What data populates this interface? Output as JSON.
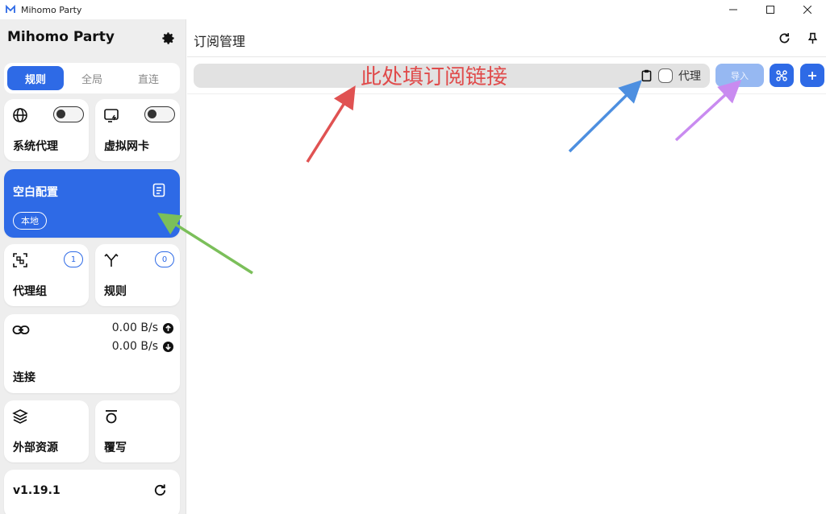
{
  "window": {
    "title": "Mihomo Party",
    "controls": [
      "minimize",
      "maximize",
      "close"
    ]
  },
  "sidebar": {
    "brand": "Mihomo Party",
    "mode_tabs": [
      {
        "label": "规则",
        "active": true
      },
      {
        "label": "全局",
        "active": false
      },
      {
        "label": "直连",
        "active": false
      }
    ],
    "system_proxy": {
      "label": "系统代理",
      "enabled": false
    },
    "tun": {
      "label": "虚拟网卡",
      "enabled": false
    },
    "profile": {
      "name": "空白配置",
      "chip": "本地"
    },
    "proxy_groups": {
      "label": "代理组",
      "count": "1"
    },
    "rules": {
      "label": "规则",
      "count": "0"
    },
    "connections": {
      "label": "连接",
      "upload": "0.00 B/s",
      "download": "0.00 B/s"
    },
    "resources": {
      "label": "外部资源"
    },
    "override": {
      "label": "覆写"
    },
    "version": {
      "label": "v1.19.1"
    }
  },
  "main": {
    "title": "订阅管理",
    "subscription_input": {
      "value": "",
      "placeholder": ""
    },
    "proxy_option_label": "代理",
    "import_button": "导入"
  },
  "annotation": {
    "text": "此处填订阅链接",
    "arrows": [
      {
        "color": "#e05252"
      },
      {
        "color": "#4d8fe0"
      },
      {
        "color": "#c98bf0"
      },
      {
        "color": "#7bbf5a"
      }
    ]
  },
  "colors": {
    "accent": "#2e6ae6",
    "import_disabled": "#96b8f2",
    "sidebar_bg": "#eeeeee"
  }
}
